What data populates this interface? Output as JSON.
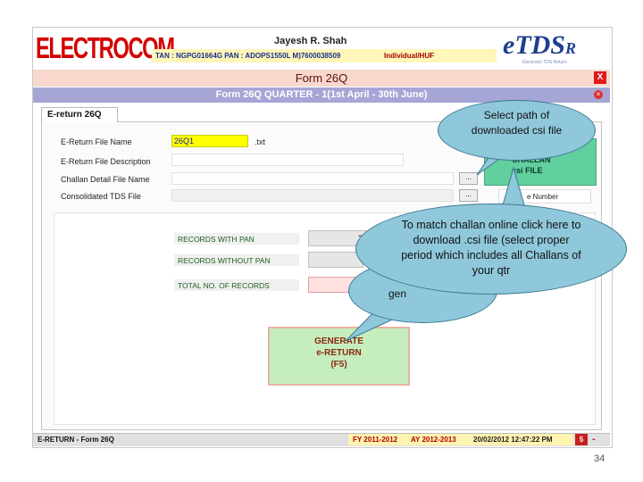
{
  "header": {
    "logo": "ELECTROCOM",
    "user_name": "Jayesh R. Shah",
    "tan_pan": "TAN : NGPG01664G  PAN : ADOPS1550L  M)7600038509",
    "category": "Individual/HUF",
    "brand": "eTDS",
    "brand_suffix": "R",
    "brand_sub": "Electronic TDS Return"
  },
  "window": {
    "title": "Form 26Q",
    "close_label": "X",
    "subtitle": "Form 26Q QUARTER - 1(1st April - 30th June)",
    "sub_close": "×"
  },
  "tab": {
    "label": "E-return  26Q"
  },
  "form": {
    "efile_label": "E-Return File Name",
    "efile_value": "26Q1",
    "efile_ext": ".txt",
    "edesc_label": "E-Return File Description",
    "edesc_value": "",
    "challan_label": "Challan Detail File Name",
    "challan_value": "",
    "consol_label": "Consolidated TDS File",
    "consol_value": "",
    "browse_label": "...",
    "gen_challan_line1": "CHALLAN",
    "gen_challan_line2": "csi FILE",
    "number_label": "e Number"
  },
  "records": {
    "with_pan_label": "RECORDS WITH PAN",
    "with_pan_value": "2",
    "without_pan_label": "RECORDS WITHOUT PAN",
    "total_label": "TOTAL NO. OF RECORDS",
    "gen_peek": "gen"
  },
  "generate": {
    "line1": "GENERATE",
    "line2": "e-RETURN",
    "line3": "(F5)"
  },
  "status_bar": {
    "left": "E-RETURN - Form 26Q",
    "fy": "FY 2011-2012",
    "ay": "AY 2012-2013",
    "datetime": "20/02/2012 12:47:22 PM",
    "badge": "5",
    "dash": "-"
  },
  "callouts": {
    "csi_path": "Select path of downloaded csi file",
    "challan_match": "To match challan online click here to download .csi file (select proper period which includes all Challans of your qtr"
  },
  "page_number": "34",
  "colors": {
    "logo_red": "#d40000",
    "title_bg": "#f8d8cc",
    "subtitle_bg": "#a6a6d6",
    "callout_fill": "#8fc8da",
    "generate_bg": "#c6edbd"
  }
}
